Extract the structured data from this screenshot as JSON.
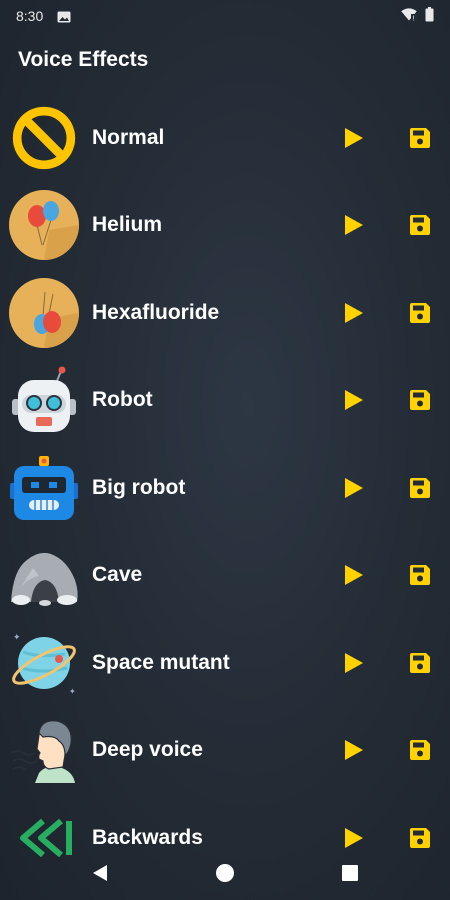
{
  "status_bar": {
    "time": "8:30",
    "icons": [
      "image-notification-icon",
      "wifi-icon",
      "battery-icon"
    ]
  },
  "header": {
    "title": "Voice Effects"
  },
  "effects": [
    {
      "name": "Normal",
      "icon": "no-effect-icon"
    },
    {
      "name": "Helium",
      "icon": "helium-balloons-icon"
    },
    {
      "name": "Hexafluoride",
      "icon": "hexafluoride-balloons-icon"
    },
    {
      "name": "Robot",
      "icon": "robot-icon"
    },
    {
      "name": "Big robot",
      "icon": "big-robot-icon"
    },
    {
      "name": "Cave",
      "icon": "cave-icon"
    },
    {
      "name": "Space mutant",
      "icon": "planet-icon"
    },
    {
      "name": "Deep voice",
      "icon": "deep-voice-icon"
    },
    {
      "name": "Backwards",
      "icon": "rewind-icon"
    }
  ],
  "row_actions": {
    "play_icon": "play-icon",
    "save_icon": "save-icon"
  },
  "nav_bar": {
    "items": [
      "back-icon",
      "home-icon",
      "recents-icon"
    ]
  },
  "colors": {
    "accent": "#ffd200",
    "background": "#232b35",
    "text": "#ffffff"
  }
}
